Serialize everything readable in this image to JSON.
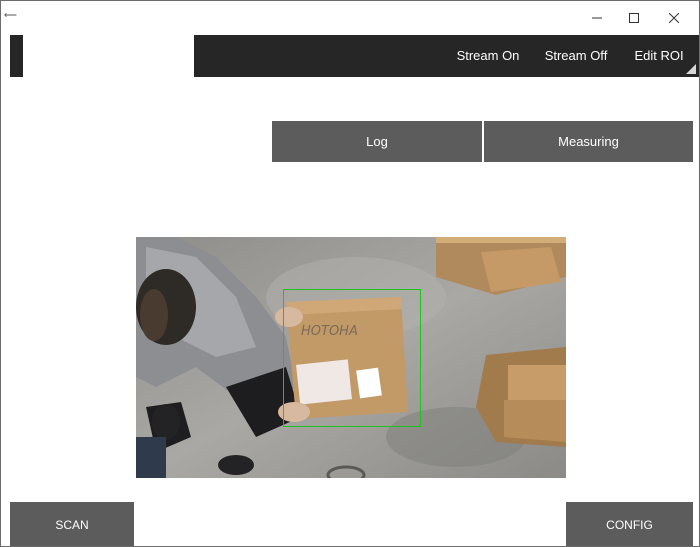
{
  "titlebar": {
    "back_icon": "back-arrow-icon",
    "minimize_icon": "minimize-icon",
    "maximize_icon": "maximize-icon",
    "close_icon": "close-icon"
  },
  "toolbar": {
    "stream_on": "Stream On",
    "stream_off": "Stream Off",
    "edit_roi": "Edit ROI"
  },
  "tabs": {
    "log": "Log",
    "measuring": "Measuring"
  },
  "camera": {
    "box_label": "НОТОНА"
  },
  "footer": {
    "scan": "SCAN",
    "config": "CONFIG"
  },
  "colors": {
    "toolbar": "#262626",
    "button": "#5c5c5c",
    "roi": "#22c21e"
  }
}
